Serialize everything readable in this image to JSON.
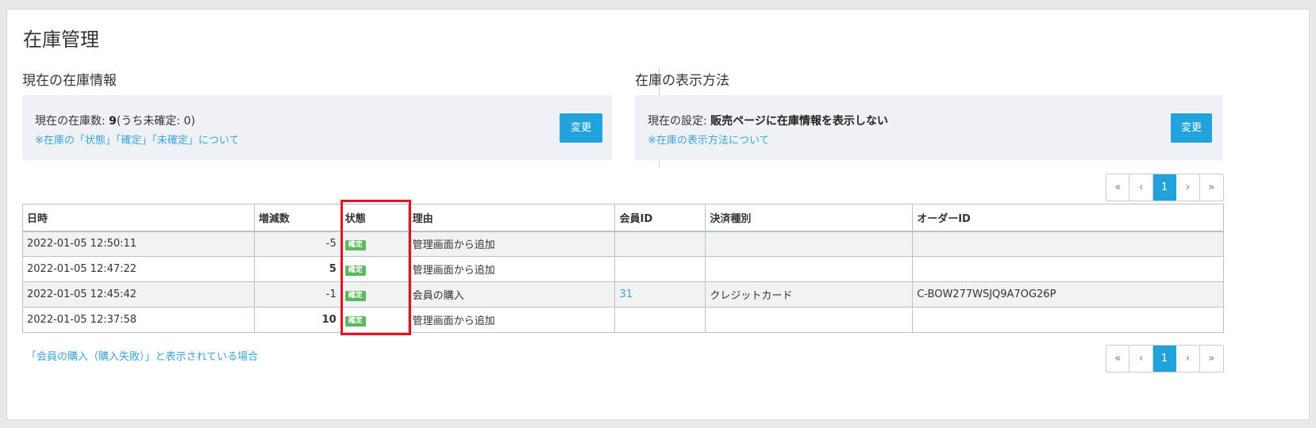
{
  "page_title": "在庫管理",
  "current_stock": {
    "section_title": "現在の在庫情報",
    "count_label": "現在の在庫数: ",
    "count_value": "9",
    "unconfirmed_text": "(うち未確定: 0)",
    "help_link": "※在庫の「状態」「確定」「未確定」について",
    "change_button": "変更"
  },
  "display_method": {
    "section_title": "在庫の表示方法",
    "setting_label": "現在の設定: ",
    "setting_value": "販売ページに在庫情報を表示しない",
    "help_link": "※在庫の表示方法について",
    "change_button": "変更"
  },
  "pagination": {
    "first": "«",
    "prev": "‹",
    "current": "1",
    "next": "›",
    "last": "»"
  },
  "table": {
    "headers": {
      "date": "日時",
      "delta": "増減数",
      "status": "状態",
      "reason": "理由",
      "member_id": "会員ID",
      "payment": "決済種別",
      "order_id": "オーダーID"
    },
    "rows": [
      {
        "date": "2022-01-05 12:50:11",
        "delta": "-5",
        "status": "確定",
        "reason": "管理画面から追加",
        "member_id": "",
        "payment": "",
        "order_id": ""
      },
      {
        "date": "2022-01-05 12:47:22",
        "delta": "5",
        "status": "確定",
        "reason": "管理画面から追加",
        "member_id": "",
        "payment": "",
        "order_id": ""
      },
      {
        "date": "2022-01-05 12:45:42",
        "delta": "-1",
        "status": "確定",
        "reason": "会員の購入",
        "member_id": "31",
        "payment": "クレジットカード",
        "order_id": "C-BOW277WSJQ9A7OG26P"
      },
      {
        "date": "2022-01-05 12:37:58",
        "delta": "10",
        "status": "確定",
        "reason": "管理画面から追加",
        "member_id": "",
        "payment": "",
        "order_id": ""
      }
    ]
  },
  "bottom_link": "「会員の購入（購入失敗）」と表示されている場合",
  "colors": {
    "accent": "#22a2db",
    "link": "#3ca4d8",
    "badge": "#5cb85c",
    "highlight": "#e0141e"
  }
}
